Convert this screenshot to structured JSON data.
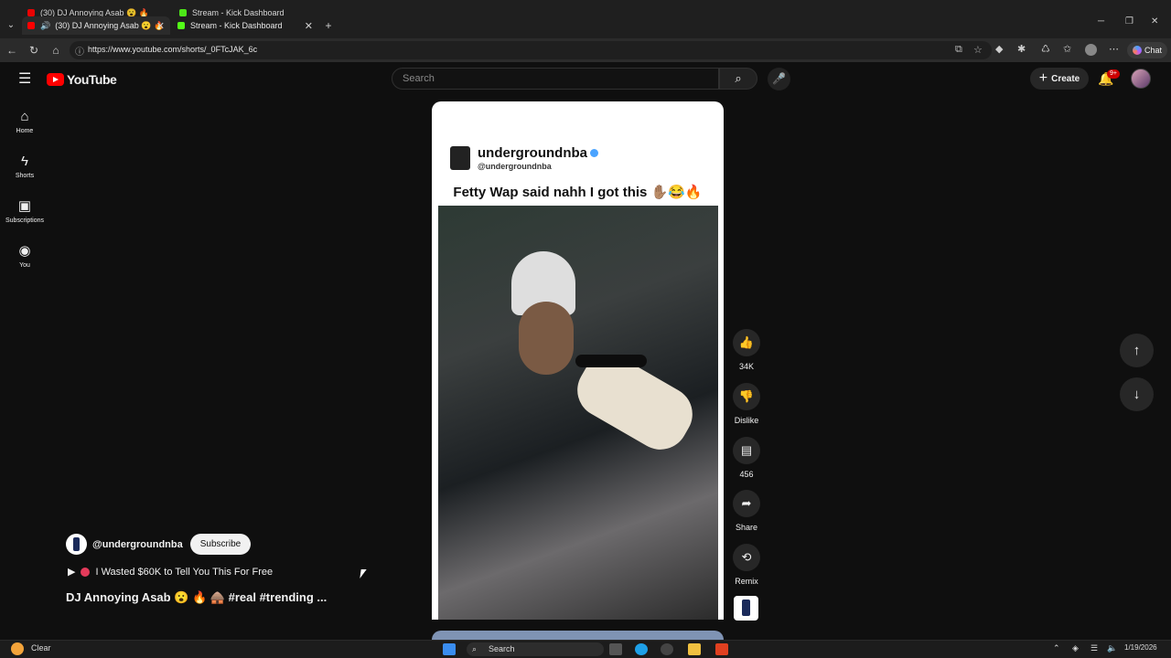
{
  "browser": {
    "ghost_tabs": [
      {
        "title": "(30) DJ Annoying Asab 😮 🔥"
      },
      {
        "title": "Stream - Kick Dashboard"
      }
    ],
    "tabs": [
      {
        "title": "(30) DJ Annoying Asab 😮 🔥",
        "active": true
      },
      {
        "title": "Stream - Kick Dashboard",
        "active": false
      }
    ],
    "url": "https://www.youtube.com/shorts/_0FTcJAK_6c",
    "chat_label": "Chat"
  },
  "youtube": {
    "logo_text": "YouTube",
    "search_placeholder": "Search",
    "create_label": "Create",
    "notification_badge": "9+",
    "sidebar": [
      {
        "label": "Home",
        "icon": "home-icon"
      },
      {
        "label": "Shorts",
        "icon": "shorts-icon"
      },
      {
        "label": "Subscriptions",
        "icon": "subscriptions-icon"
      },
      {
        "label": "You",
        "icon": "you-icon"
      }
    ],
    "short": {
      "overlay_username": "undergroundnba",
      "overlay_handle": "@undergroundnba",
      "overlay_caption": "Fetty Wap said nahh I got this ✋🏽😂🔥"
    },
    "actions": {
      "like_count": "34K",
      "dislike_label": "Dislike",
      "comment_count": "456",
      "share_label": "Share",
      "remix_label": "Remix"
    },
    "channel": {
      "handle": "@undergroundnba",
      "subscribe_label": "Subscribe"
    },
    "music_track": "I Wasted $60K to Tell You This For Free",
    "video_title": "DJ Annoying Asab 😮 🔥 🛖 #real #trending ..."
  },
  "taskbar": {
    "weather_label": "Clear",
    "search_label": "Search",
    "date": "1/19/2026"
  }
}
